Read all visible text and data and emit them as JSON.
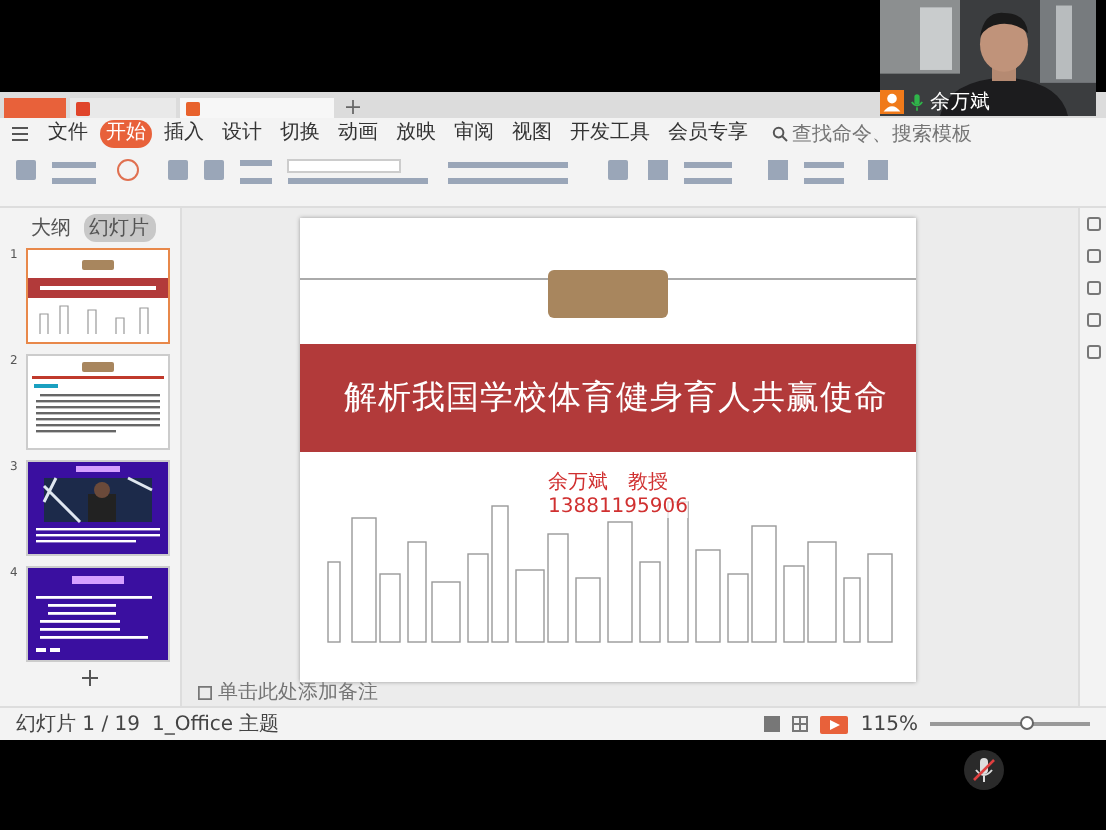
{
  "menu": [
    {
      "label": "文件",
      "selected": false
    },
    {
      "label": "开始",
      "selected": true
    },
    {
      "label": "插入",
      "selected": false
    },
    {
      "label": "设计",
      "selected": false
    },
    {
      "label": "切换",
      "selected": false
    },
    {
      "label": "动画",
      "selected": false
    },
    {
      "label": "放映",
      "selected": false
    },
    {
      "label": "审阅",
      "selected": false
    },
    {
      "label": "视图",
      "selected": false
    },
    {
      "label": "开发工具",
      "selected": false
    },
    {
      "label": "会员专享",
      "selected": false
    }
  ],
  "search": {
    "placeholder": "查找命令、搜索模板"
  },
  "outline_tabs": [
    {
      "label": "大纲",
      "selected": false
    },
    {
      "label": "幻灯片",
      "selected": true
    }
  ],
  "thumbnails": [
    {
      "number": "1",
      "kind": "title",
      "selected": true
    },
    {
      "number": "2",
      "kind": "text",
      "selected": false
    },
    {
      "number": "3",
      "selected": false
    },
    {
      "number": "4",
      "kind": "list",
      "selected": false
    }
  ],
  "slide": {
    "title": "解析我国学校体育健身育人共赢使命",
    "author": "余万斌　教授",
    "phone": "13881195906"
  },
  "notes": {
    "placeholder": "单击此处添加备注"
  },
  "status_bar": {
    "slide_counter": "幻灯片 1 / 19",
    "theme": "1_Office 主题",
    "zoom": "115%",
    "zoom_slider": {
      "level": 0.6
    }
  },
  "video": {
    "name": "余万斌"
  }
}
